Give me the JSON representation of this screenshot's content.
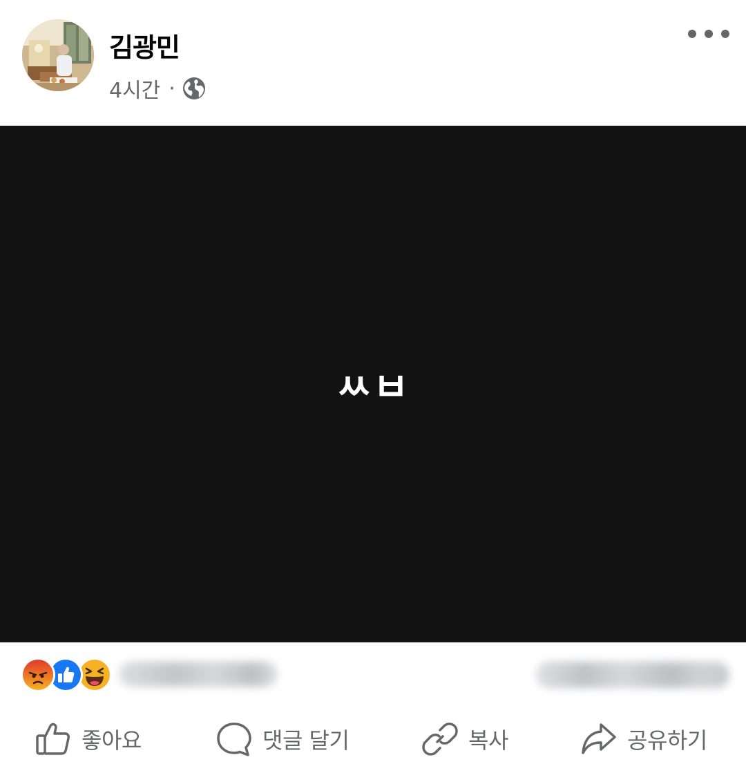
{
  "post": {
    "author_name": "김광민",
    "time": "4시간",
    "separator": "·",
    "privacy_icon": "globe-icon",
    "more_icon": "more-options-icon"
  },
  "media": {
    "text": "ㅆㅂ",
    "background_color": "#121212",
    "text_color": "#ffffff"
  },
  "reactions": {
    "icons": [
      "angry-reaction-icon",
      "like-reaction-icon",
      "haha-reaction-icon"
    ]
  },
  "actions": {
    "like_label": "좋아요",
    "comment_label": "댓글 달기",
    "copy_label": "복사",
    "share_label": "공유하기"
  },
  "colors": {
    "secondary_text": "#65676b",
    "like_blue": "#1877f2",
    "angry_orange": "#e9710f",
    "haha_yellow": "#f7b125"
  }
}
